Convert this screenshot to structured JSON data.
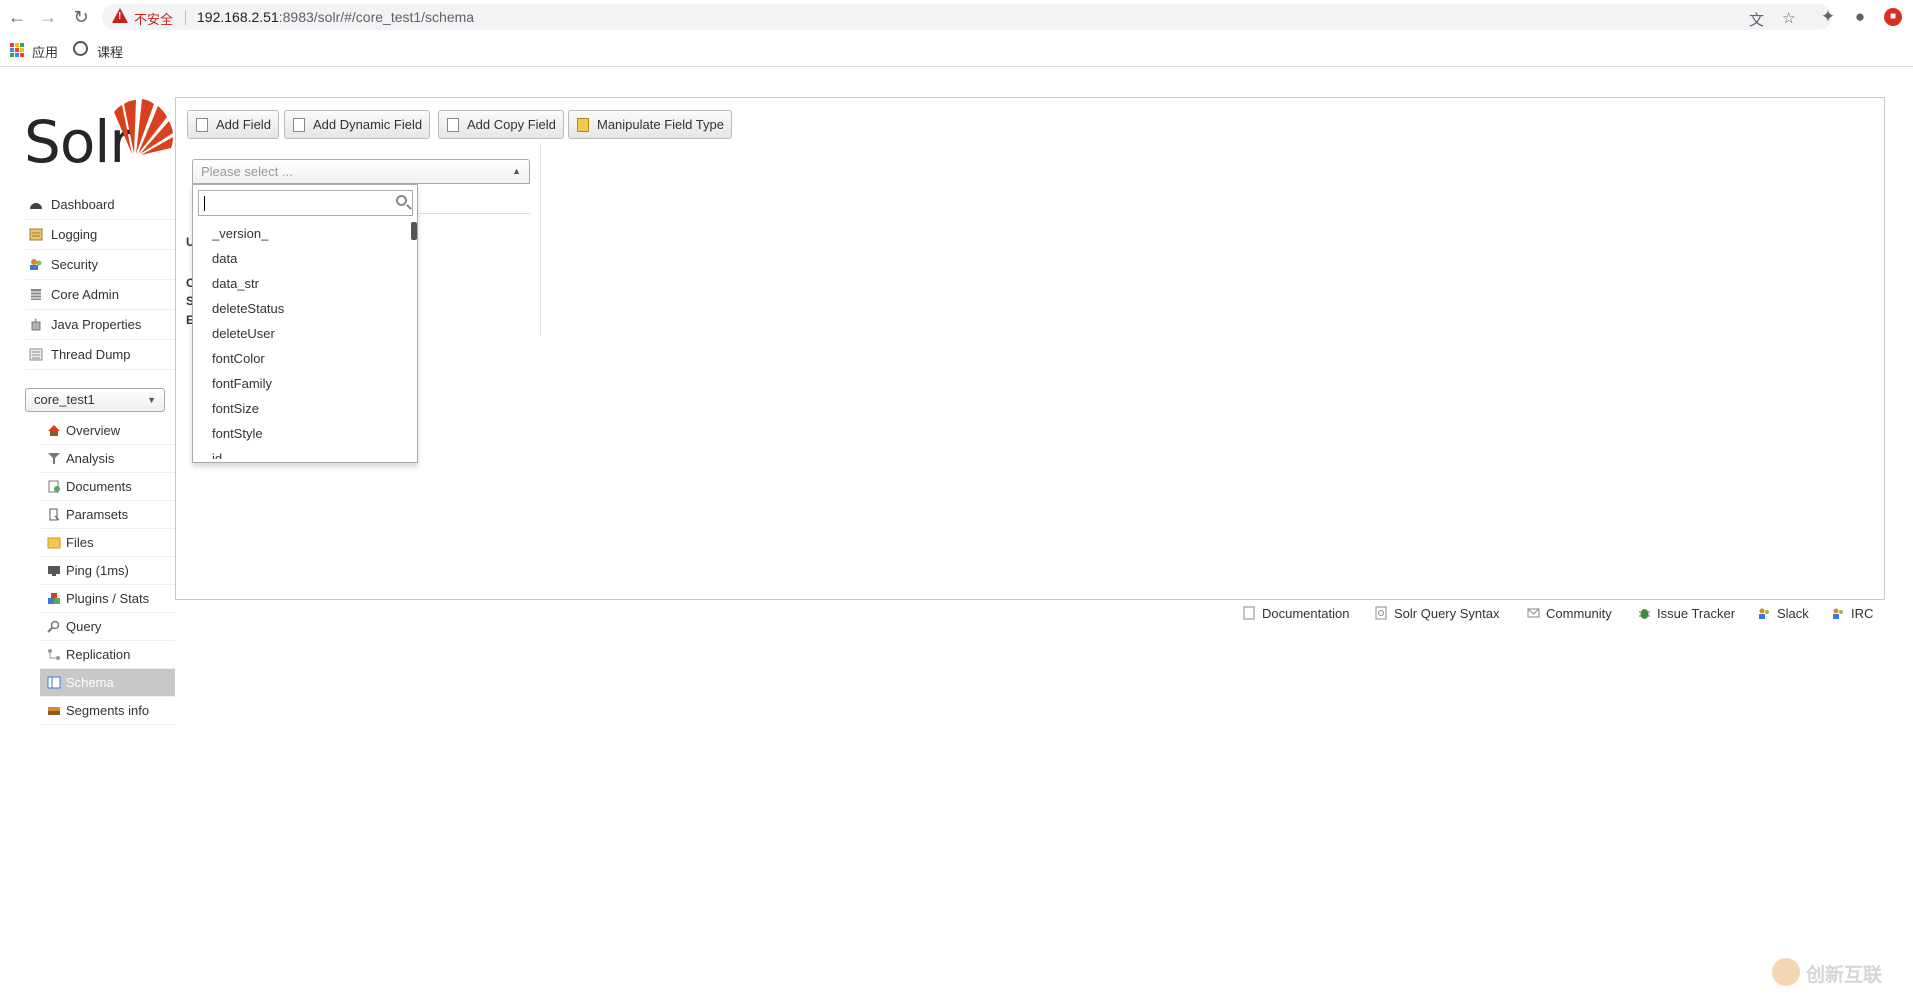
{
  "browser": {
    "insecure_label": "不安全",
    "url_host": "192.168.2.51",
    "url_rest": ":8983/solr/#/core_test1/schema",
    "bookmarks": [
      "应用",
      "课程"
    ]
  },
  "logo": {
    "text": "Solr"
  },
  "nav": {
    "items": [
      "Dashboard",
      "Logging",
      "Security",
      "Core Admin",
      "Java Properties",
      "Thread Dump"
    ]
  },
  "core_selector": {
    "value": "core_test1"
  },
  "subnav": {
    "items": [
      "Overview",
      "Analysis",
      "Documents",
      "Paramsets",
      "Files",
      "Ping (1ms)",
      "Plugins / Stats",
      "Query",
      "Replication",
      "Schema",
      "Segments info"
    ],
    "active": "Schema"
  },
  "toolbar": {
    "add_field": "Add Field",
    "add_dynamic_field": "Add Dynamic Field",
    "add_copy_field": "Add Copy Field",
    "manipulate_field_type": "Manipulate Field Type"
  },
  "field_select": {
    "placeholder": "Please select ...",
    "options": [
      "_version_",
      "data",
      "data_str",
      "deleteStatus",
      "deleteUser",
      "fontColor",
      "fontFamily",
      "fontSize",
      "fontStyle",
      "id"
    ]
  },
  "partial_letters": [
    "U",
    "C",
    "S",
    "E"
  ],
  "footer": {
    "links": [
      "Documentation",
      "Solr Query Syntax",
      "Community",
      "Issue Tracker",
      "Slack",
      "IRC"
    ]
  },
  "watermark": {
    "text": "创新互联"
  },
  "colors": {
    "solr_red": "#d9411e",
    "insecure_red": "#c5221f",
    "active_nav": "#c8c8c8"
  }
}
